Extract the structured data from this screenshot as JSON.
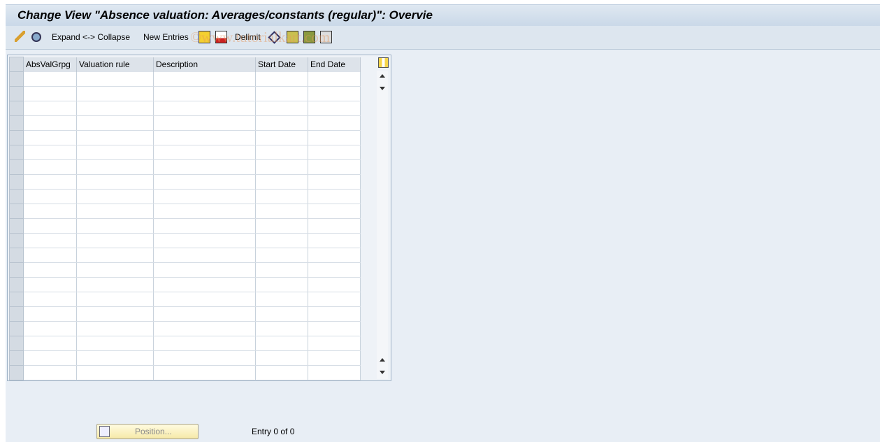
{
  "title": "Change View \"Absence valuation: Averages/constants (regular)\": Overvie",
  "toolbar": {
    "expand_collapse": "Expand <-> Collapse",
    "new_entries": "New Entries",
    "delimit": "Delimit"
  },
  "watermark": "©www.tutorialkart.com",
  "table": {
    "columns": [
      "AbsValGrpg",
      "Valuation rule",
      "Description",
      "Start Date",
      "End Date"
    ],
    "row_count": 21,
    "rows": []
  },
  "footer": {
    "position_button": "Position...",
    "entry_info": "Entry 0 of 0"
  }
}
